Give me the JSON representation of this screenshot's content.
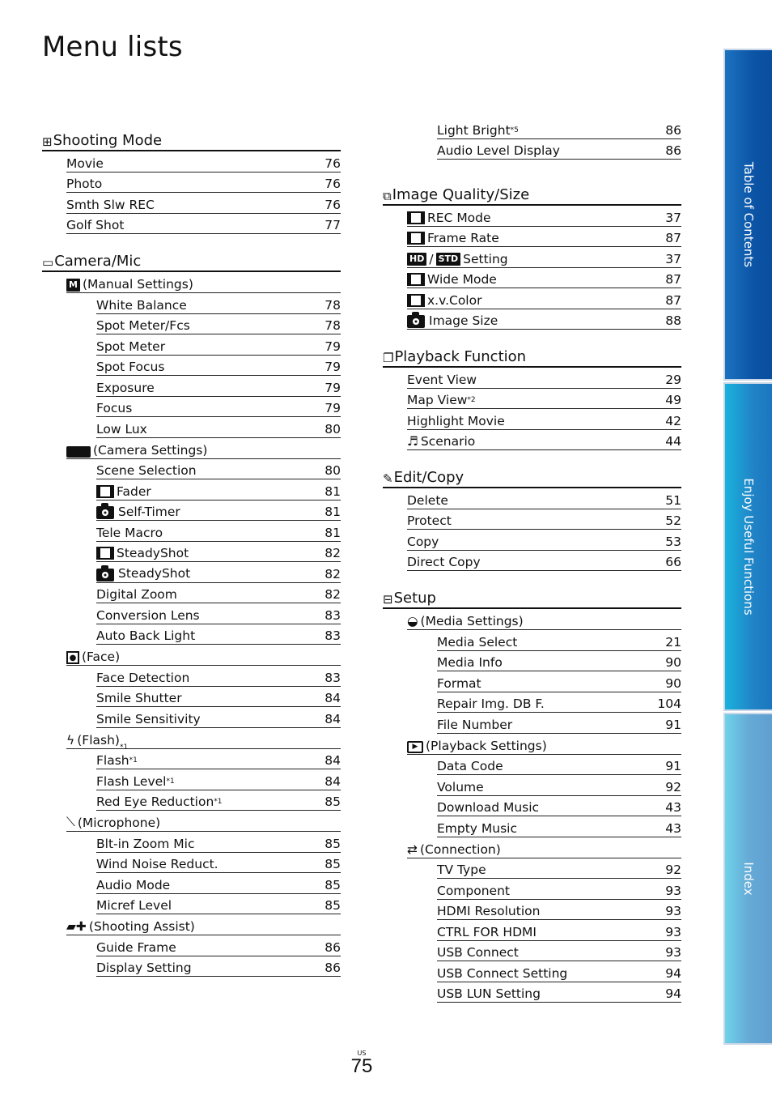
{
  "page": {
    "title": "Menu lists",
    "country_code": "US",
    "page_number": "75"
  },
  "side_tabs": [
    {
      "label": "Table of Contents"
    },
    {
      "label": "Enjoy Useful Functions"
    },
    {
      "label": "Index"
    }
  ],
  "left": {
    "shooting_mode": {
      "icon": "shooting-mode-icon",
      "title": "Shooting Mode",
      "items": [
        {
          "label": "Movie",
          "page": "76"
        },
        {
          "label": "Photo",
          "page": "76"
        },
        {
          "label": "Smth Slw REC",
          "page": "76"
        },
        {
          "label": "Golf Shot",
          "page": "77"
        }
      ]
    },
    "camera_mic": {
      "icon": "camera-mic-icon",
      "title": "Camera/Mic",
      "manual": {
        "title": "(Manual Settings)",
        "items": [
          {
            "label": "White Balance",
            "page": "78"
          },
          {
            "label": "Spot Meter/Fcs",
            "page": "78"
          },
          {
            "label": "Spot Meter",
            "page": "79"
          },
          {
            "label": "Spot Focus",
            "page": "79"
          },
          {
            "label": "Exposure",
            "page": "79"
          },
          {
            "label": "Focus",
            "page": "79"
          },
          {
            "label": "Low Lux",
            "page": "80"
          }
        ]
      },
      "camera": {
        "title": "(Camera Settings)",
        "items": [
          {
            "label": "Scene Selection",
            "page": "80",
            "icon": ""
          },
          {
            "label": "Fader",
            "page": "81",
            "icon": "movie"
          },
          {
            "label": "Self-Timer",
            "page": "81",
            "icon": "photo"
          },
          {
            "label": "Tele Macro",
            "page": "81",
            "icon": ""
          },
          {
            "label": "SteadyShot",
            "page": "82",
            "icon": "movie"
          },
          {
            "label": "SteadyShot",
            "page": "82",
            "icon": "photo"
          },
          {
            "label": "Digital Zoom",
            "page": "82",
            "icon": ""
          },
          {
            "label": "Conversion Lens",
            "page": "83",
            "icon": ""
          },
          {
            "label": "Auto Back Light",
            "page": "83",
            "icon": ""
          }
        ]
      },
      "face": {
        "title": "(Face)",
        "items": [
          {
            "label": "Face Detection",
            "page": "83"
          },
          {
            "label": "Smile Shutter",
            "page": "84"
          },
          {
            "label": "Smile Sensitivity",
            "page": "84"
          }
        ]
      },
      "flash": {
        "title": "(Flash)",
        "note": "*1",
        "items": [
          {
            "label": "Flash",
            "note": "*1",
            "page": "84"
          },
          {
            "label": "Flash Level",
            "note": "*1",
            "page": "84"
          },
          {
            "label": "Red Eye Reduction",
            "note": "*1",
            "page": "85"
          }
        ]
      },
      "microphone": {
        "title": "(Microphone)",
        "items": [
          {
            "label": "Blt-in Zoom Mic",
            "page": "85"
          },
          {
            "label": "Wind Noise Reduct.",
            "page": "85"
          },
          {
            "label": "Audio Mode",
            "page": "85"
          },
          {
            "label": "Micref Level",
            "page": "85"
          }
        ]
      },
      "assist": {
        "title": "(Shooting Assist)",
        "items": [
          {
            "label": "Guide Frame",
            "page": "86"
          },
          {
            "label": "Display Setting",
            "page": "86"
          }
        ]
      }
    }
  },
  "right": {
    "assist_cont": {
      "items": [
        {
          "label": "Light Bright",
          "note": "*5",
          "page": "86"
        },
        {
          "label": "Audio Level Display",
          "note": "",
          "page": "86"
        }
      ]
    },
    "image_quality": {
      "icon": "image-quality-icon",
      "title": "Image Quality/Size",
      "items": [
        {
          "label": "REC Mode",
          "page": "37",
          "icon": "movie"
        },
        {
          "label": "Frame Rate",
          "page": "87",
          "icon": "movie"
        },
        {
          "label": "Setting",
          "page": "37",
          "icon": "hdstd",
          "badge_hd": "HD",
          "badge_std": "STD",
          "sep": "/"
        },
        {
          "label": "Wide Mode",
          "page": "87",
          "icon": "movie"
        },
        {
          "label": "x.v.Color",
          "page": "87",
          "icon": "movie"
        },
        {
          "label": "Image Size",
          "page": "88",
          "icon": "photo"
        }
      ]
    },
    "playback": {
      "icon": "playback-function-icon",
      "title": "Playback Function",
      "items": [
        {
          "label": "Event View",
          "page": "29",
          "note": ""
        },
        {
          "label": "Map View",
          "page": "49",
          "note": "*2"
        },
        {
          "label": "Highlight Movie",
          "page": "42",
          "note": ""
        },
        {
          "label": "Scenario",
          "page": "44",
          "note": ""
        }
      ]
    },
    "edit_copy": {
      "icon": "edit-copy-icon",
      "title": "Edit/Copy",
      "items": [
        {
          "label": "Delete",
          "page": "51"
        },
        {
          "label": "Protect",
          "page": "52"
        },
        {
          "label": "Copy",
          "page": "53"
        },
        {
          "label": "Direct Copy",
          "page": "66"
        }
      ]
    },
    "setup": {
      "icon": "setup-icon",
      "title": "Setup",
      "media": {
        "title": "(Media Settings)",
        "items": [
          {
            "label": "Media Select",
            "page": "21"
          },
          {
            "label": "Media Info",
            "page": "90"
          },
          {
            "label": "Format",
            "page": "90"
          },
          {
            "label": "Repair Img. DB F.",
            "page": "104"
          },
          {
            "label": "File Number",
            "page": "91"
          }
        ]
      },
      "playback_settings": {
        "title": "(Playback Settings)",
        "items": [
          {
            "label": "Data Code",
            "page": "91"
          },
          {
            "label": "Volume",
            "page": "92"
          },
          {
            "label": "Download Music",
            "page": "43"
          },
          {
            "label": "Empty Music",
            "page": "43"
          }
        ]
      },
      "connection": {
        "title": "(Connection)",
        "items": [
          {
            "label": "TV Type",
            "page": "92"
          },
          {
            "label": "Component",
            "page": "93"
          },
          {
            "label": "HDMI Resolution",
            "page": "93"
          },
          {
            "label": "CTRL FOR HDMI",
            "page": "93"
          },
          {
            "label": "USB Connect",
            "page": "93"
          },
          {
            "label": "USB Connect Setting",
            "page": "94"
          },
          {
            "label": "USB LUN Setting",
            "page": "94"
          }
        ]
      }
    }
  }
}
